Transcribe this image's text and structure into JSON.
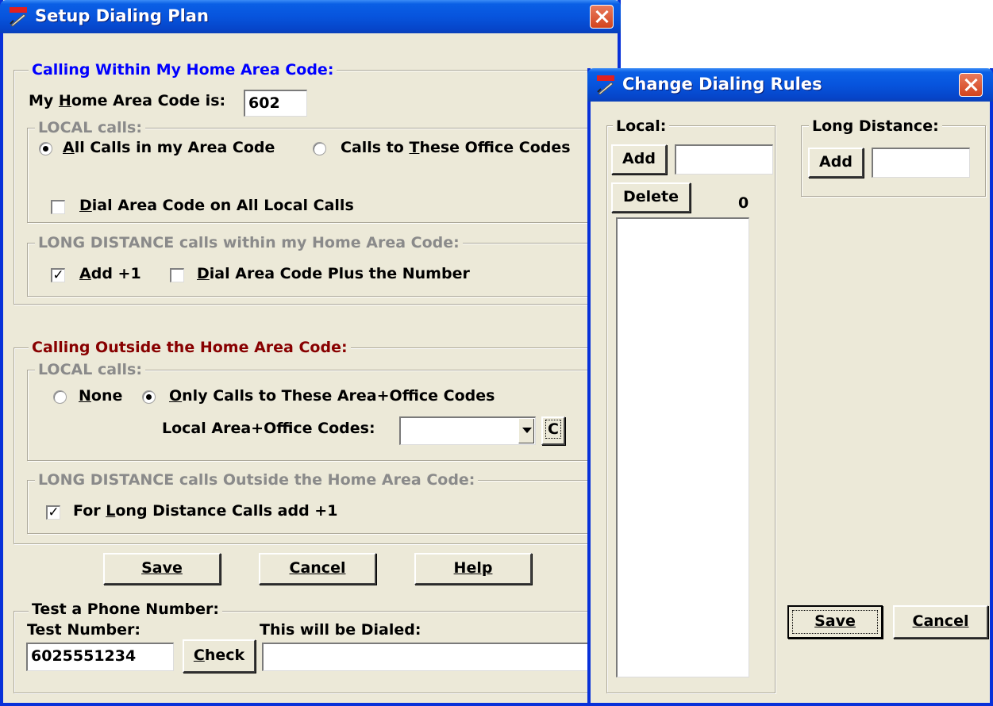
{
  "setup": {
    "title": "Setup Dialing Plan",
    "home": {
      "legend": "Calling Within My Home Area Code:",
      "area_code_label": "My Home Area Code is:",
      "area_code_value": "602",
      "local_legend": "LOCAL calls:",
      "radio_all": "All Calls in my Area Code",
      "radio_office": "Calls to These Office Codes",
      "dial_area_code_label": "Dial Area Code on All Local Calls",
      "long_legend": "LONG DISTANCE calls within my Home Area Code:",
      "add_plus1_label": "Add +1",
      "dial_area_plus_label": "Dial Area Code Plus the Number"
    },
    "outside": {
      "legend": "Calling Outside the Home Area Code:",
      "local_legend": "LOCAL calls:",
      "radio_none": "None",
      "radio_only": "Only Calls to These Area+Office Codes",
      "codes_label": "Local Area+Office Codes:",
      "codes_value": "",
      "c_button": "C",
      "long_legend": "LONG DISTANCE calls Outside the Home Area Code:",
      "long_add_label": "For Long Distance Calls add +1"
    },
    "buttons": {
      "save": "Save",
      "cancel": "Cancel",
      "help": "Help"
    },
    "test": {
      "legend": "Test a Phone Number:",
      "number_label": "Test Number:",
      "number_value": "6025551234",
      "check_button": "Check",
      "dialed_label": "This will be Dialed:",
      "dialed_value": ""
    }
  },
  "rules": {
    "title": "Change Dialing Rules",
    "local_legend": "Local:",
    "local_add": "Add",
    "local_input": "",
    "delete_button": "Delete",
    "count": "0",
    "long_legend": "Long Distance:",
    "long_add": "Add",
    "long_input": "",
    "save": "Save",
    "cancel": "Cancel"
  },
  "colors": {
    "title_bar": "#0754dd",
    "window_bg": "#ece9d8",
    "legend_blue": "#0000ff",
    "legend_red": "#880000",
    "legend_gray": "#8a8a8a",
    "close_button": "#d2441e"
  },
  "icons": [
    "app-icon",
    "close-icon",
    "chevron-down-icon"
  ]
}
